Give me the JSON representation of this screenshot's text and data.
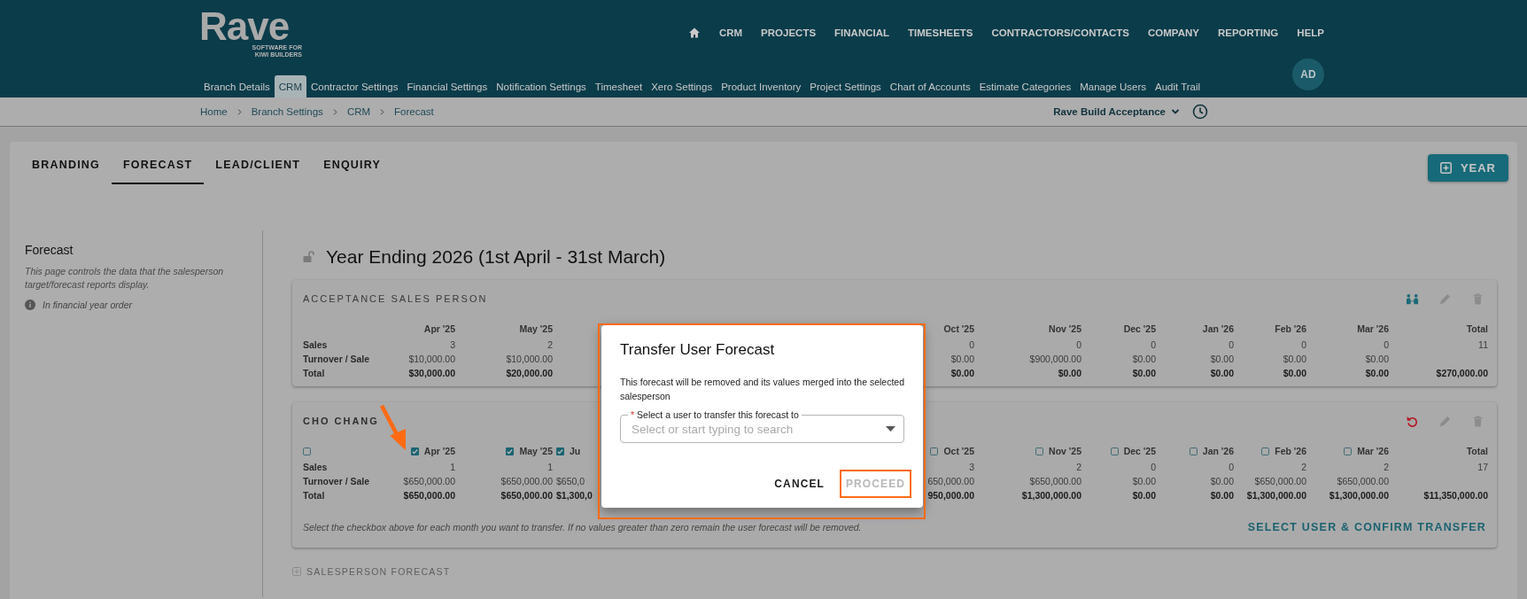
{
  "logo": {
    "name": "Rave",
    "tagline_1": "SOFTWARE FOR",
    "tagline_2": "KIWI BUILDERS"
  },
  "top_nav": [
    "CRM",
    "PROJECTS",
    "FINANCIAL",
    "TIMESHEETS",
    "CONTRACTORS/CONTACTS",
    "COMPANY",
    "REPORTING",
    "HELP"
  ],
  "settings_nav": [
    {
      "label": "Branch Details",
      "selected": false
    },
    {
      "label": "CRM",
      "selected": true
    },
    {
      "label": "Contractor Settings",
      "selected": false
    },
    {
      "label": "Financial Settings",
      "selected": false
    },
    {
      "label": "Notification Settings",
      "selected": false
    },
    {
      "label": "Timesheet",
      "selected": false
    },
    {
      "label": "Xero Settings",
      "selected": false
    },
    {
      "label": "Product Inventory",
      "selected": false
    },
    {
      "label": "Project Settings",
      "selected": false
    },
    {
      "label": "Chart of Accounts",
      "selected": false
    },
    {
      "label": "Estimate Categories",
      "selected": false
    },
    {
      "label": "Manage Users",
      "selected": false
    },
    {
      "label": "Audit Trail",
      "selected": false
    }
  ],
  "avatar": "AD",
  "breadcrumb": [
    "Home",
    "Branch Settings",
    "CRM",
    "Forecast"
  ],
  "company_selector": "Rave Build Acceptance",
  "tabs": [
    {
      "label": "BRANDING",
      "selected": false
    },
    {
      "label": "FORECAST",
      "selected": true
    },
    {
      "label": "LEAD/CLIENT",
      "selected": false
    },
    {
      "label": "ENQUIRY",
      "selected": false
    }
  ],
  "year_button": "YEAR",
  "sidebar": {
    "title": "Forecast",
    "description": "This page controls the data that the salesperson target/forecast reports display.",
    "note": "In financial year order"
  },
  "title": "Year Ending 2026 (1st April - 31st March)",
  "forecasts": [
    {
      "name": "ACCEPTANCE SALES PERSON",
      "kind": "summary",
      "row_labels": [
        "Sales",
        "Turnover / Sale",
        "Total"
      ],
      "columns_before_dialog": [
        {
          "header": "Apr '25",
          "sales": "3",
          "turnover": "$10,000.00",
          "total": "$30,000.00"
        },
        {
          "header": "May '25",
          "sales": "2",
          "turnover": "$10,000.00",
          "total": "$20,000.00"
        }
      ],
      "columns_after_dialog": [
        {
          "header": "Oct '25",
          "sales": "0",
          "turnover": "$0.00",
          "total": "$0.00"
        },
        {
          "header": "Nov '25",
          "sales": "0",
          "turnover": "$900,000.00",
          "total": "$0.00"
        },
        {
          "header": "Dec '25",
          "sales": "0",
          "turnover": "$0.00",
          "total": "$0.00"
        },
        {
          "header": "Jan '26",
          "sales": "0",
          "turnover": "$0.00",
          "total": "$0.00"
        },
        {
          "header": "Feb '26",
          "sales": "0",
          "turnover": "$0.00",
          "total": "$0.00"
        },
        {
          "header": "Mar '26",
          "sales": "0",
          "turnover": "$0.00",
          "total": "$0.00"
        }
      ],
      "total_column": {
        "header": "Total",
        "sales": "11",
        "total": "$270,000.00"
      }
    },
    {
      "name": "CHO CHANG",
      "kind": "transfer",
      "select_all_checked": false,
      "row_labels": [
        "Sales",
        "Turnover / Sale",
        "Total"
      ],
      "columns_before_dialog": [
        {
          "header": "Apr '25",
          "checked": true,
          "sales": "1",
          "turnover": "$650,000.00",
          "total": "$650,000.00"
        },
        {
          "header": "May '25",
          "checked": true,
          "sales": "1",
          "turnover": "$650,000.00",
          "total": "$650,000.00"
        },
        {
          "header": "Ju",
          "checked": true,
          "turnover": "$650,0",
          "total": "$1,300,0"
        }
      ],
      "columns_after_dialog": [
        {
          "header": "Oct '25",
          "checked": false,
          "sales": "3",
          "turnover": "650,000.00",
          "total": "950,000.00"
        },
        {
          "header": "Nov '25",
          "checked": false,
          "sales": "2",
          "turnover": "$650,000.00",
          "total": "$1,300,000.00"
        },
        {
          "header": "Dec '25",
          "checked": false,
          "sales": "0",
          "turnover": "$0.00",
          "total": "$0.00"
        },
        {
          "header": "Jan '26",
          "checked": false,
          "sales": "0",
          "turnover": "$0.00",
          "total": "$0.00"
        },
        {
          "header": "Feb '26",
          "checked": false,
          "sales": "2",
          "turnover": "$650,000.00",
          "total": "$1,300,000.00"
        },
        {
          "header": "Mar '26",
          "checked": false,
          "sales": "2",
          "turnover": "$650,000.00",
          "total": "$1,300,000.00"
        }
      ],
      "total_column": {
        "header": "Total",
        "sales": "17",
        "total": "$11,350,000.00"
      },
      "note": "Select the checkbox above for each month you want to transfer. If no values greater than zero remain the user forecast will be removed.",
      "action": "SELECT USER & CONFIRM TRANSFER"
    }
  ],
  "add_salesperson": "SALESPERSON FORECAST",
  "dialog": {
    "title": "Transfer User Forecast",
    "message": "This forecast will be removed and its values merged into the selected salesperson",
    "required_mark": "*",
    "field_label": "Select a user to transfer this forecast to",
    "placeholder": "Select or start typing to search",
    "buttons": [
      {
        "label": "CANCEL",
        "disabled": false,
        "highlighted": false
      },
      {
        "label": "PROCEED",
        "disabled": true,
        "highlighted": true
      }
    ]
  }
}
